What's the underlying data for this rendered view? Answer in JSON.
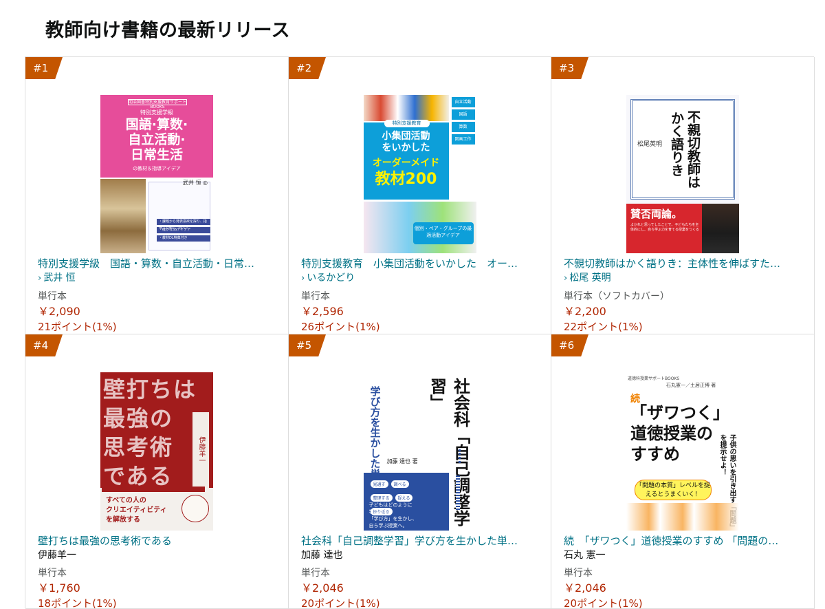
{
  "page": {
    "title": "教師向け書籍の最新リリース"
  },
  "books": [
    {
      "rank": "#1",
      "title": "特別支援学級　国語・算数・自立活動・日常…",
      "author": "武井 恒",
      "author_link": true,
      "format": "単行本",
      "price": "￥2,090",
      "points": "21ポイント(1%)",
      "cover": {
        "series": "明治図書特別支援教育サポートBOOKS",
        "subtitle": "特別支援学級",
        "lines": [
          "国語·算数·",
          "自立活動·",
          "日常生活"
        ],
        "tail": "の教材＆指導アイデア",
        "author": "武井 恒 ◎",
        "bullets": [
          "・課題から発表意欲を探り、指導・支援につなぐ！",
          "・確かなSSアイデア",
          "・教材DL特典付き"
        ]
      }
    },
    {
      "rank": "#2",
      "title": "特別支援教育　小集団活動をいかした　オー…",
      "author": "いるかどり",
      "author_link": true,
      "format": "単行本",
      "price": "￥2,596",
      "points": "26ポイント(1%)",
      "cover": {
        "series": "特別支援教育",
        "line1": "小集団活動",
        "line1b": "をいかした",
        "line2": "オーダーメイド",
        "line3": "教材200",
        "side": [
          "自立活動",
          "国語",
          "算数",
          "図画工作"
        ],
        "band": "個別・ペア・グループの最適活動アイデア"
      }
    },
    {
      "rank": "#3",
      "title": "不親切教師はかく語りき：主体性を伸ばすた…",
      "author": "松尾 英明",
      "author_link": true,
      "format": "単行本（ソフトカバー）",
      "price": "￥2,200",
      "points": "22ポイント(1%)",
      "cover": {
        "line1": "不親切教師は",
        "line2": "かく語りき",
        "name": "松尾英明",
        "red_title": "賛否両論。",
        "red_sub": "よかれと思ってしたことで、子どもたちを主体的にし、自ら学ぶ力を育てる授業をつくる"
      }
    },
    {
      "rank": "#4",
      "title": "壁打ちは最強の思考術である",
      "author": "伊藤羊一",
      "author_link": false,
      "format": "単行本",
      "price": "￥1,760",
      "points": "18ポイント(1%)",
      "cover": {
        "lines": [
          "壁打ちは",
          "最強の",
          "思考術",
          "である"
        ],
        "author": "伊藤羊一",
        "white": [
          "すべての人の",
          "クリエイティビティ",
          "を解放する"
        ]
      }
    },
    {
      "rank": "#5",
      "title": "社会科「自己調整学習」学び方を生かした単…",
      "author": "加藤 達也",
      "author_link": false,
      "format": "単行本",
      "price": "￥2,046",
      "points": "20ポイント(1%)",
      "cover": {
        "left": "学び方を生かした単元デザイン",
        "main": "社会科「自己調整学習」",
        "author": "加藤 達也 著",
        "chips": [
          "見通す",
          "調べる",
          "整理する",
          "捉える",
          "振り返る"
        ],
        "blue_text": [
          "子どもはどのように",
          "学ぶのか。",
          "「学び方」を生かし、",
          "自ら学ぶ授業へ。"
        ]
      }
    },
    {
      "rank": "#6",
      "title": "続　「ザワつく」道徳授業のすすめ 「問題の…",
      "author": "石丸 憲一",
      "author_link": false,
      "format": "単行本",
      "price": "￥2,046",
      "points": "20ポイント(1%)",
      "cover": {
        "series": "道徳科授業サポートBOOKS",
        "author": "石丸憲一／土居正博 著",
        "zoku": "続",
        "main": [
          "「ザワつく」",
          "道徳授業の",
          "すすめ"
        ],
        "side": "子供の思いを引き出す「問題」を提示せよ！",
        "yellow": "「問題の本質」レベルを捉えるとうまくいく！"
      }
    }
  ],
  "colors": {
    "rank_badge": "#c45500",
    "link": "#007185",
    "price": "#b12704",
    "muted": "#565959"
  }
}
